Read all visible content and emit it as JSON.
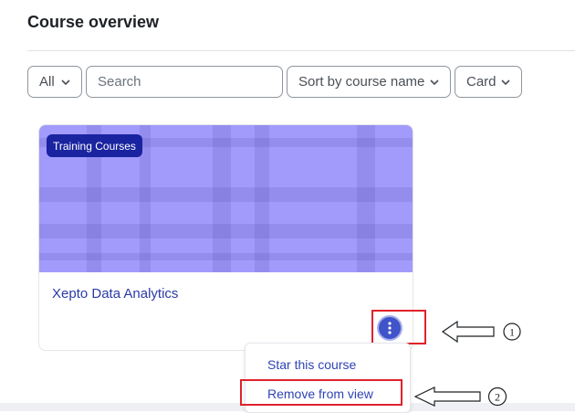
{
  "section": {
    "title": "Course overview"
  },
  "filters": {
    "grouping": {
      "selected": "All"
    },
    "search": {
      "placeholder": "Search",
      "value": ""
    },
    "sort": {
      "selected": "Sort by course name"
    },
    "view": {
      "selected": "Card"
    }
  },
  "course": {
    "category": "Training Courses",
    "name": "Xepto Data Analytics",
    "image_color": "#a29bfc",
    "actions_icon": "kebab-menu-icon"
  },
  "menu": {
    "items": [
      "Star this course",
      "Remove from view"
    ]
  },
  "annotations": {
    "markers": [
      "1",
      "2"
    ],
    "highlight_color": "#e0222b"
  },
  "colors": {
    "accent": "#3f54c8",
    "badge": "#1a24a0",
    "link": "#2a3aa8"
  }
}
